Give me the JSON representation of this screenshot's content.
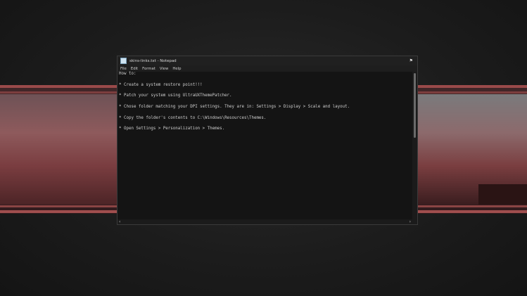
{
  "window": {
    "title": "skins-links.txt - Notepad",
    "pin_icon": "pin-icon"
  },
  "menu": [
    "File",
    "Edit",
    "Format",
    "View",
    "Help"
  ],
  "content": {
    "lines": [
      "How to:",
      "",
      "* Create a system restore point!!!",
      "",
      "* Patch your system using UltraUXThemePatcher.",
      "",
      "* Chose folder matching your DPI settings. They are in: Settings > Display > Scale and layout.",
      "",
      "* Copy the folder's contents to C:\\Windows\\Resources\\Themes.",
      "",
      "* Open Settings > Personalization > Themes."
    ]
  },
  "scrollbar": {
    "left_arrow": "‹",
    "right_arrow": "›"
  },
  "colors": {
    "accent": "#9a4a4a",
    "editor_bg": "#141414",
    "text": "#cfcfcf"
  }
}
